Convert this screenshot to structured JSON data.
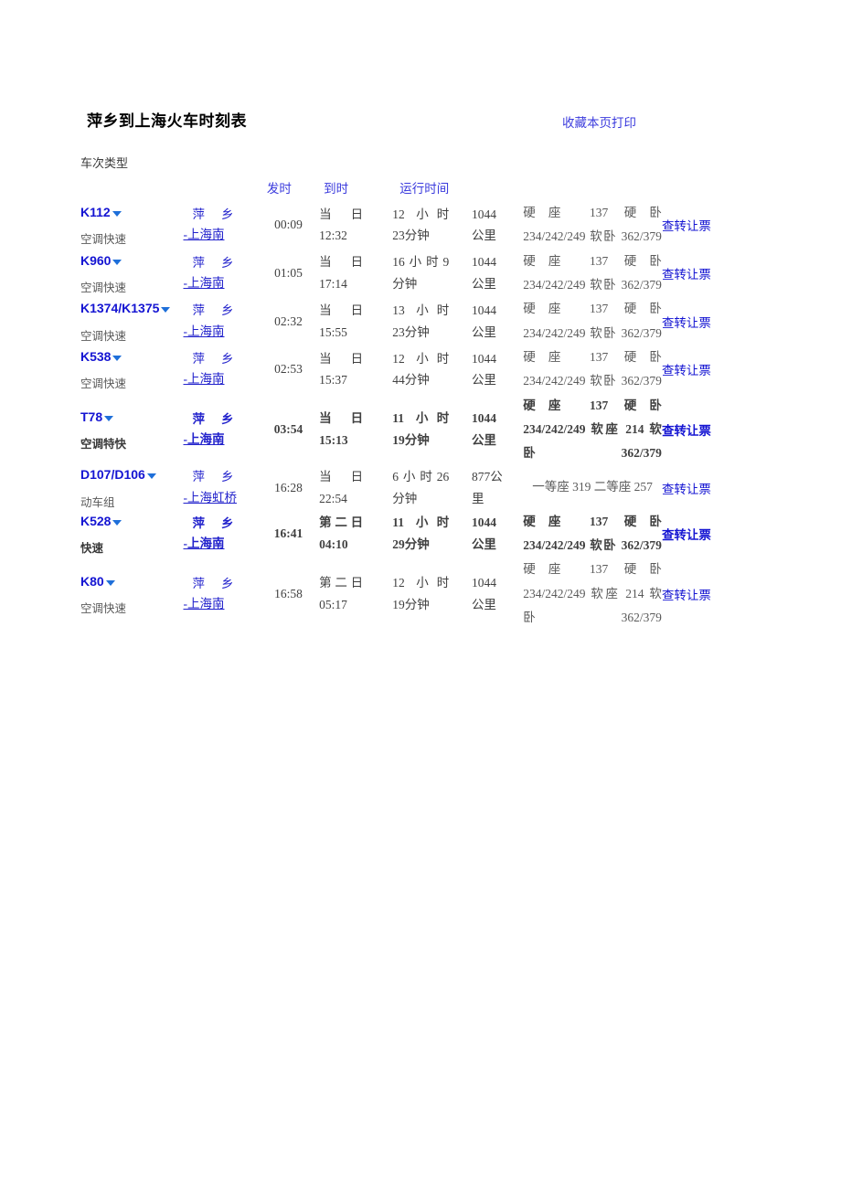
{
  "header": {
    "title": "萍乡到上海火车时刻表",
    "bookmark_label": "收藏本页",
    "print_label": "打印",
    "type_label": "车次类型"
  },
  "columns": {
    "train_no": "",
    "station": "",
    "depart": "发时",
    "arrive": "到时",
    "duration": "运行时间",
    "distance": "",
    "price": "",
    "action": ""
  },
  "colors": {
    "link": "#1414d2",
    "header_link": "#3b3bdd",
    "station_link": "#2222cc",
    "muted": "#5a5a5a",
    "caret": "#1e6fd9"
  },
  "action_label": "查转让票",
  "rows": [
    {
      "train_no": "K112",
      "train_type": "空调快速",
      "from": "萍乡",
      "to": "-上海南",
      "depart": "00:09",
      "arrive_day": "当日",
      "arrive_time": "12:32",
      "duration_1": "12 小时",
      "duration_2": "23分钟",
      "distance_1": "1044",
      "distance_2": "公里",
      "price": "硬座 137 硬卧 234/242/249 软卧 362/379",
      "action": "查转让票",
      "bold": false
    },
    {
      "train_no": "K960",
      "train_type": "空调快速",
      "from": "萍乡",
      "to": "-上海南",
      "depart": "01:05",
      "arrive_day": "当日",
      "arrive_time": "17:14",
      "duration_1": "16小时9",
      "duration_2": "分钟",
      "distance_1": "1044",
      "distance_2": "公里",
      "price": "硬座 137 硬卧 234/242/249 软卧 362/379",
      "action": "查转让票",
      "bold": false
    },
    {
      "train_no": "K1374/K1375",
      "train_type": "空调快速",
      "from": "萍乡",
      "to": "-上海南",
      "depart": "02:32",
      "arrive_day": "当日",
      "arrive_time": "15:55",
      "duration_1": "13 小时",
      "duration_2": "23分钟",
      "distance_1": "1044",
      "distance_2": "公里",
      "price": "硬座 137 硬卧 234/242/249 软卧 362/379",
      "action": "查转让票",
      "bold": false
    },
    {
      "train_no": "K538",
      "train_type": "空调快速",
      "from": "萍乡",
      "to": "-上海南",
      "depart": "02:53",
      "arrive_day": "当日",
      "arrive_time": "15:37",
      "duration_1": "12 小时",
      "duration_2": "44分钟",
      "distance_1": "1044",
      "distance_2": "公里",
      "price": "硬座 137 硬卧 234/242/249 软卧 362/379",
      "action": "查转让票",
      "bold": false
    },
    {
      "train_no": "T78",
      "train_type": "空调特快",
      "from": "萍乡",
      "to": "-上海南",
      "depart": "03:54",
      "arrive_day": "当日",
      "arrive_time": "15:13",
      "duration_1": "11 小时",
      "duration_2": "19分钟",
      "distance_1": "1044",
      "distance_2": "公里",
      "price": "硬座 137 硬卧 234/242/249 软座 214 软卧 362/379",
      "action": "查转让票",
      "bold": true
    },
    {
      "train_no": "D107/D106",
      "train_type": "动车组",
      "from": "萍乡",
      "to": "-上海虹桥",
      "depart": "16:28",
      "arrive_day": "当日",
      "arrive_time": "22:54",
      "duration_1": "6小时26",
      "duration_2": "分钟",
      "distance_1": "877公",
      "distance_2": "里",
      "price": "一等座 319 二等座 257",
      "action": "查转让票",
      "bold": false
    },
    {
      "train_no": "K528",
      "train_type": "快速",
      "from": "萍乡",
      "to": "-上海南",
      "depart": "16:41",
      "arrive_day": "第二日",
      "arrive_time": "04:10",
      "duration_1": "11 小时",
      "duration_2": "29分钟",
      "distance_1": "1044",
      "distance_2": "公里",
      "price": "硬座 137 硬卧 234/242/249 软卧 362/379",
      "action": "查转让票",
      "bold": true
    },
    {
      "train_no": "K80",
      "train_type": "空调快速",
      "from": "萍乡",
      "to": "-上海南",
      "depart": "16:58",
      "arrive_day": "第二日",
      "arrive_time": "05:17",
      "duration_1": "12 小时",
      "duration_2": "19分钟",
      "distance_1": "1044",
      "distance_2": "公里",
      "price": "硬座 137 硬卧 234/242/249 软座 214 软卧 362/379",
      "action": "查转让票",
      "bold": false
    }
  ]
}
